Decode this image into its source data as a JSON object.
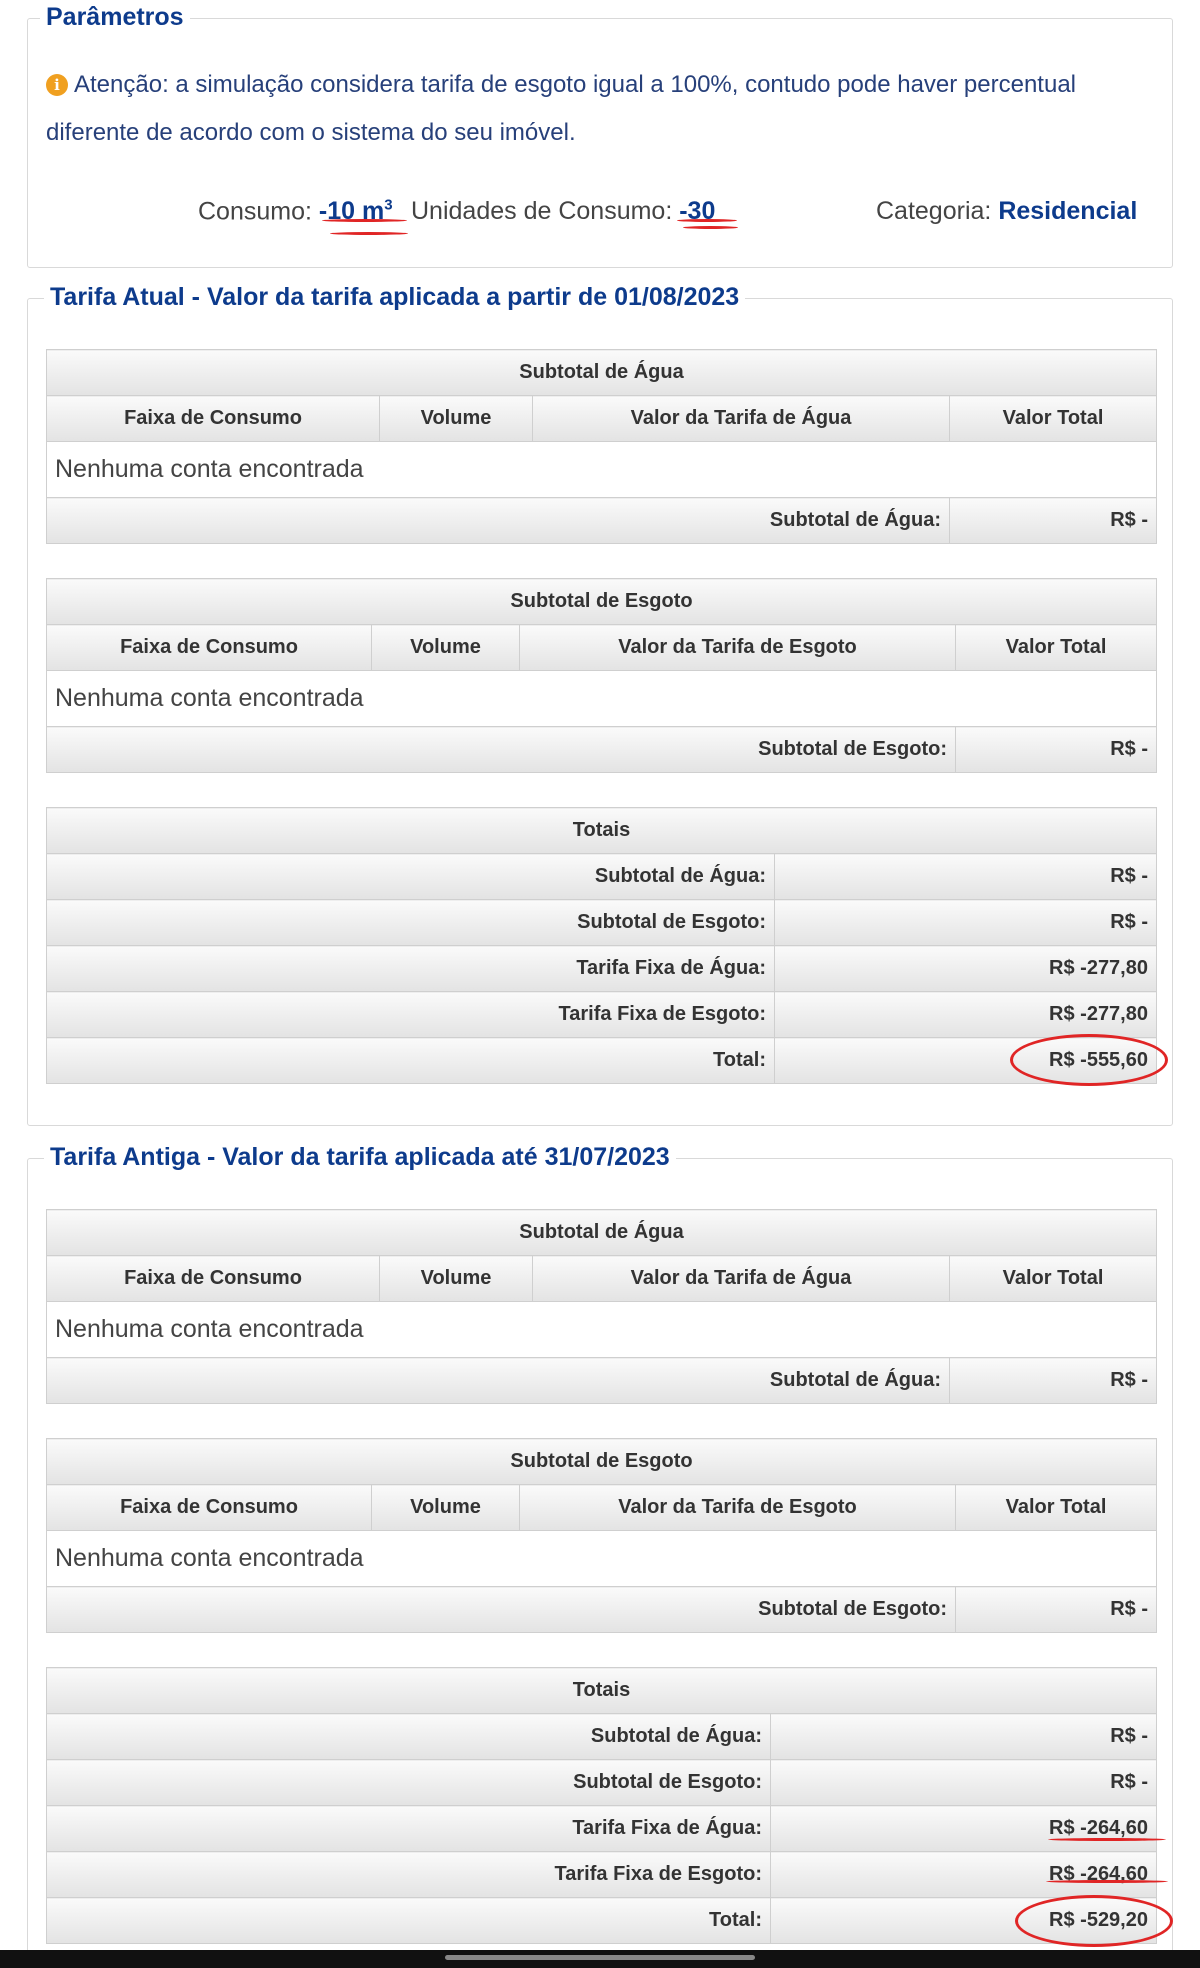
{
  "params": {
    "legend": "Parâmetros",
    "notice": "Atenção: a simulação considera tarifa de esgoto igual a 100%, contudo pode haver percentual diferente de acordo com o sistema do seu imóvel.",
    "consumo_label": "Consumo:",
    "consumo_value": "-10 m",
    "consumo_sup": "3",
    "unidades_label": "Unidades de Consumo:",
    "unidades_value": "-30",
    "categoria_label": "Categoria:",
    "categoria_value": "Residencial"
  },
  "sections": [
    {
      "legend": "Tarifa Atual - Valor da tarifa aplicada a partir de 01/08/2023",
      "agua": {
        "title": "Subtotal de Água",
        "headers": [
          "Faixa de Consumo",
          "Volume",
          "Valor da Tarifa de Água",
          "Valor Total"
        ],
        "empty": "Nenhuma conta encontrada",
        "sum_label": "Subtotal de Água:",
        "sum_value": "R$ -"
      },
      "esgoto": {
        "title": "Subtotal de Esgoto",
        "headers": [
          "Faixa de Consumo",
          "Volume",
          "Valor da Tarifa de Esgoto",
          "Valor Total"
        ],
        "empty": "Nenhuma conta encontrada",
        "sum_label": "Subtotal de Esgoto:",
        "sum_value": "R$ -"
      },
      "totais": {
        "title": "Totais",
        "rows": [
          {
            "label": "Subtotal de Água:",
            "value": "R$ -"
          },
          {
            "label": "Subtotal de Esgoto:",
            "value": "R$ -"
          },
          {
            "label": "Tarifa Fixa de Água:",
            "value": "R$ -277,80"
          },
          {
            "label": "Tarifa Fixa de Esgoto:",
            "value": "R$ -277,80"
          },
          {
            "label": "Total:",
            "value": "R$ -555,60"
          }
        ]
      }
    },
    {
      "legend": "Tarifa Antiga - Valor da tarifa aplicada até 31/07/2023",
      "agua": {
        "title": "Subtotal de Água",
        "headers": [
          "Faixa de Consumo",
          "Volume",
          "Valor da Tarifa de Água",
          "Valor Total"
        ],
        "empty": "Nenhuma conta encontrada",
        "sum_label": "Subtotal de Água:",
        "sum_value": "R$ -"
      },
      "esgoto": {
        "title": "Subtotal de Esgoto",
        "headers": [
          "Faixa de Consumo",
          "Volume",
          "Valor da Tarifa de Esgoto",
          "Valor Total"
        ],
        "empty": "Nenhuma conta encontrada",
        "sum_label": "Subtotal de Esgoto:",
        "sum_value": "R$ -"
      },
      "totais": {
        "title": "Totais",
        "rows": [
          {
            "label": "Subtotal de Água:",
            "value": "R$ -"
          },
          {
            "label": "Subtotal de Esgoto:",
            "value": "R$ -"
          },
          {
            "label": "Tarifa Fixa de Água:",
            "value": "R$ -264,60"
          },
          {
            "label": "Tarifa Fixa de Esgoto:",
            "value": "R$ -264,60"
          },
          {
            "label": "Total:",
            "value": "R$ -529,20"
          }
        ]
      }
    }
  ],
  "colors": {
    "accent": "#0d3b8c",
    "annotation": "#e02525",
    "info": "#f0a020"
  }
}
